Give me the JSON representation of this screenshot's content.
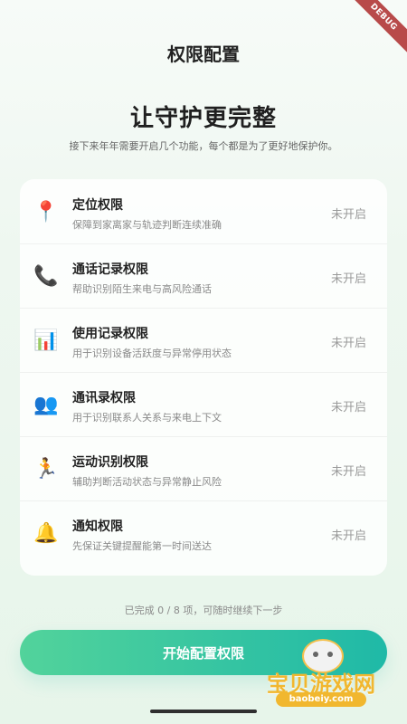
{
  "status_banner": {
    "debug_label": "DEBUG"
  },
  "header": {
    "title": "权限配置"
  },
  "hero": {
    "title": "让守护更完整",
    "subtitle": "接下来年年需要开启几个功能，每个都是为了更好地保护你。"
  },
  "permissions": [
    {
      "icon": "location-pin-icon",
      "icon_glyph": "📍",
      "title": "定位权限",
      "description": "保障到家离家与轨迹判断连续准确",
      "status": "未开启"
    },
    {
      "icon": "phone-icon",
      "icon_glyph": "📞",
      "title": "通话记录权限",
      "description": "帮助识别陌生来电与高风险通话",
      "status": "未开启"
    },
    {
      "icon": "usage-chart-icon",
      "icon_glyph": "📊",
      "title": "使用记录权限",
      "description": "用于识别设备活跃度与异常停用状态",
      "status": "未开启"
    },
    {
      "icon": "contacts-icon",
      "icon_glyph": "👥",
      "title": "通讯录权限",
      "description": "用于识别联系人关系与来电上下文",
      "status": "未开启"
    },
    {
      "icon": "running-icon",
      "icon_glyph": "🏃",
      "title": "运动识别权限",
      "description": "辅助判断活动状态与异常静止风险",
      "status": "未开启"
    },
    {
      "icon": "bell-icon",
      "icon_glyph": "🔔",
      "title": "通知权限",
      "description": "先保证关键提醒能第一时间送达",
      "status": "未开启"
    }
  ],
  "footer": {
    "progress_text": "已完成 0 / 8 项，可随时继续下一步",
    "primary_button_label": "开始配置权限"
  },
  "watermark": {
    "logo_icon": "game-controller-icon",
    "text": "宝贝游戏网",
    "url": "baobeiy.com"
  },
  "colors": {
    "accent_start": "#52d39b",
    "accent_end": "#1fb9a7",
    "debug": "#b84a4a"
  }
}
